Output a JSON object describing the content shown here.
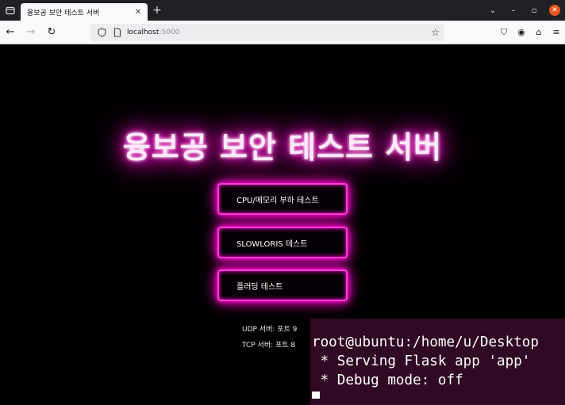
{
  "browser": {
    "tab": {
      "title": "융보공 보안 테스트 서버"
    },
    "address": {
      "host": "localhost",
      "port": ":5000"
    }
  },
  "page": {
    "title": "융보공 보안 테스트 서버",
    "buttons": [
      {
        "label": "CPU/메모리 부하 테스트"
      },
      {
        "label": "SLOWLORIS 테스트"
      },
      {
        "label": "플러딩 테스트"
      }
    ],
    "server_info": [
      "UDP 서버: 포트 9",
      "TCP 서버: 포트 8"
    ]
  },
  "terminal": {
    "lines": [
      "root@ubuntu:/home/u/Desktop",
      " * Serving Flask app 'app'",
      " * Debug mode: off"
    ]
  },
  "colors": {
    "neon_accent": "#ff00cc",
    "terminal_bg": "#300a24",
    "window_close": "#e95420"
  }
}
